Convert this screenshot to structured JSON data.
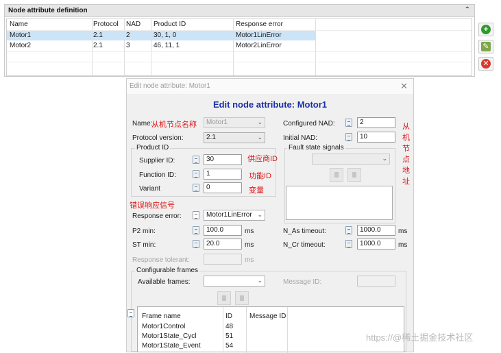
{
  "panel": {
    "title": "Node attribute definition",
    "collapse_glyph": "⌃",
    "columns": [
      "Name",
      "Protocol",
      "NAD",
      "Product ID",
      "Response error"
    ],
    "rows": [
      {
        "name": "Motor1",
        "protocol": "2.1",
        "nad": "2",
        "product_id": "30, 1, 0",
        "response_error": "Motor1LinError"
      },
      {
        "name": "Motor2",
        "protocol": "2.1",
        "nad": "3",
        "product_id": "46, 11, 1",
        "response_error": "Motor2LinError"
      }
    ],
    "buttons": {
      "add": "+",
      "edit": "✎",
      "delete": "✕"
    }
  },
  "dialog": {
    "window_title": "Edit node attribute: Motor1",
    "close_glyph": "✕",
    "heading": "Edit node attribute: Motor1",
    "name_label": "Name:",
    "name_annotation": "从机节点名称",
    "name_value": "Motor1",
    "protocol_label": "Protocol version:",
    "protocol_value": "2.1",
    "configured_nad_label": "Configured NAD:",
    "configured_nad_value": "2",
    "nad_annotation": "从机节点地址",
    "initial_nad_label": "Initial NAD:",
    "initial_nad_value": "10",
    "product_id_group": "Product ID",
    "supplier_label": "Supplier ID:",
    "supplier_value": "30",
    "supplier_annotation": "供应商ID",
    "function_label": "Function ID:",
    "function_value": "1",
    "function_annotation": "功能ID",
    "variant_label": "Variant",
    "variant_value": "0",
    "variant_annotation": "变量",
    "fault_group": "Fault state signals",
    "response_annotation": "错误响应信号",
    "response_label": "Response error:",
    "response_value": "Motor1LinError",
    "p2_label": "P2 min:",
    "p2_value": "100.0",
    "p2_unit": "ms",
    "st_label": "ST min:",
    "st_value": "20.0",
    "st_unit": "ms",
    "nas_label": "N_As timeout:",
    "nas_value": "1000.0",
    "nas_unit": "ms",
    "ncr_label": "N_Cr timeout:",
    "ncr_value": "1000.0",
    "ncr_unit": "ms",
    "tolerant_label": "Response tolerant:",
    "tolerant_unit": "ms",
    "config_frames_group": "Configurable frames",
    "available_frames_label": "Available frames:",
    "message_id_label": "Message ID:",
    "frame_columns": [
      "Frame name",
      "ID",
      "Message ID"
    ],
    "frames": [
      {
        "name": "Motor1Control",
        "id": "48",
        "message_id": ""
      },
      {
        "name": "Motor1State_Cycl",
        "id": "51",
        "message_id": ""
      },
      {
        "name": "Motor1State_Event",
        "id": "54",
        "message_id": ""
      }
    ]
  },
  "watermark": "https://@稀土掘金技术社区",
  "colors": {
    "heading": "#1a2fa6",
    "annotation": "#dd1111",
    "selection": "#cde4f7"
  }
}
